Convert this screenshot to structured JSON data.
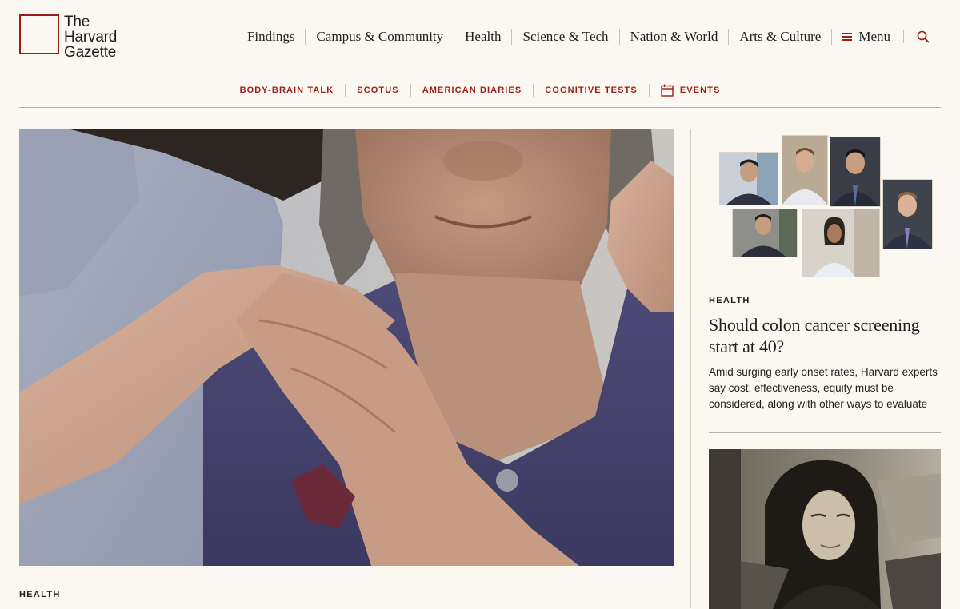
{
  "logo": {
    "line1": "The",
    "line2": "Harvard",
    "line3": "Gazette",
    "color": "#9c1c18"
  },
  "topnav": {
    "items": [
      "Findings",
      "Campus & Community",
      "Health",
      "Science & Tech",
      "Nation & World",
      "Arts & Culture"
    ],
    "menu_label": "Menu",
    "menu_icon": "hamburger-icon",
    "search_icon": "search-icon"
  },
  "subnav": {
    "items": [
      "BODY-BRAIN TALK",
      "SCOTUS",
      "AMERICAN DIARIES",
      "COGNITIVE TESTS"
    ],
    "events_label": "EVENTS",
    "events_icon": "calendar-icon"
  },
  "main_story": {
    "category": "HEALTH"
  },
  "side_story": {
    "category": "HEALTH",
    "title": "Should colon cancer screening start at 40?",
    "description": "Amid surging early onset rates, Harvard experts say cost, effectiveness, equity must be considered, along with other ways to evaluate"
  },
  "colors": {
    "accent": "#9c1c18",
    "background": "#fbf8f1",
    "text": "#1e1e1e"
  }
}
